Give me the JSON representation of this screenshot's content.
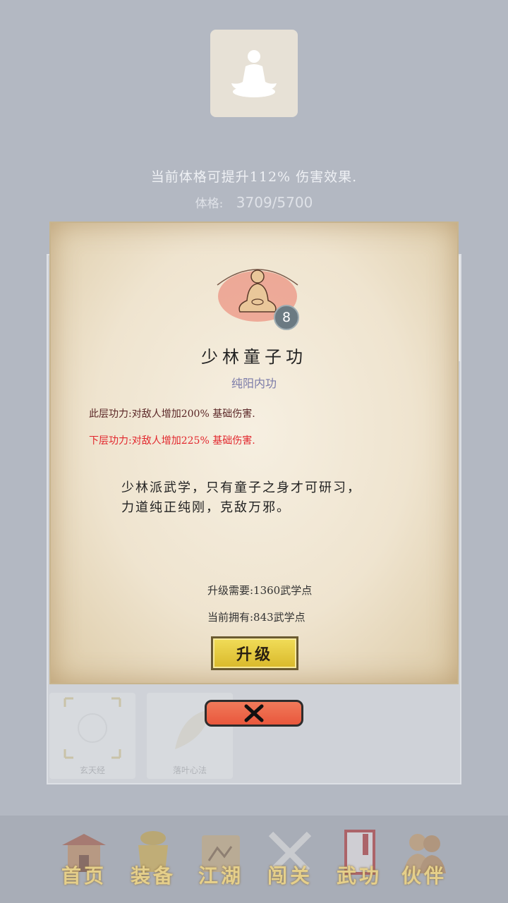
{
  "physique": {
    "bonus_text": "当前体格可提升112% 伤害效果.",
    "label": "体格:",
    "value": "3709/5700"
  },
  "skill": {
    "level": "8",
    "name": "少林童子功",
    "type": "纯阳内功",
    "current_effect": "此层功力:对敌人增加200% 基础伤害.",
    "next_effect": "下层功力:对敌人增加225% 基础伤害.",
    "description_line1": "少林派武学，只有童子之身才可研习，",
    "description_line2": "力道纯正纯刚，克敌万邪。",
    "cost_required": "升级需要:1360武学点",
    "cost_owned": "当前拥有:843武学点",
    "upgrade_label": "升级"
  },
  "background_list": {
    "cards": [
      {
        "caption": "玄天经"
      },
      {
        "caption": "落叶心法"
      }
    ]
  },
  "nav": [
    {
      "label": "首页",
      "icon": "temple-icon"
    },
    {
      "label": "装备",
      "icon": "armor-icon"
    },
    {
      "label": "江湖",
      "icon": "scroll-map-icon"
    },
    {
      "label": "闯关",
      "icon": "crossed-swords-icon"
    },
    {
      "label": "武功",
      "icon": "book-icon"
    },
    {
      "label": "伙伴",
      "icon": "partners-icon"
    }
  ],
  "colors": {
    "accent_gold": "#e5cf8a",
    "next_effect_red": "#e2262c",
    "upgrade_yellow": "#f1dd59",
    "close_red": "#e9573c"
  }
}
